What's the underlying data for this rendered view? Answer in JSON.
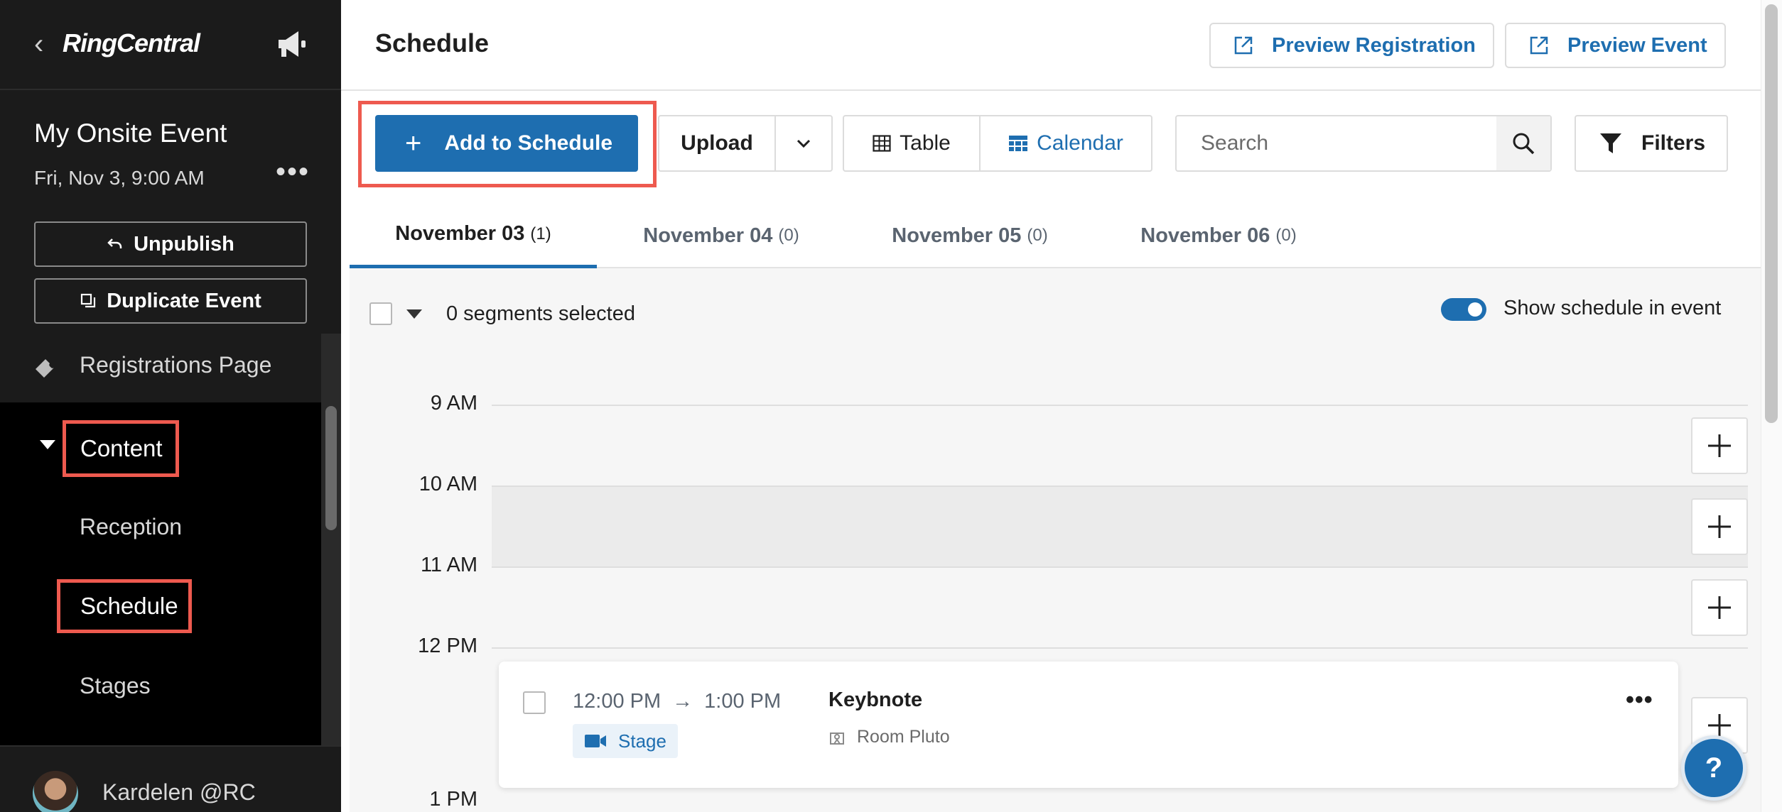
{
  "sidebar": {
    "brand": "RingCentral",
    "event_title": "My Onsite Event",
    "event_date": "Fri, Nov 3, 9:00 AM",
    "unpublish_label": "Unpublish",
    "duplicate_label": "Duplicate Event",
    "registrations_label": "Registrations Page",
    "content_label": "Content",
    "items": [
      {
        "label": "Reception"
      },
      {
        "label": "Schedule"
      },
      {
        "label": "Stages"
      }
    ],
    "user_name": "Kardelen @RC"
  },
  "header": {
    "title": "Schedule",
    "preview_registration": "Preview Registration",
    "preview_event": "Preview Event"
  },
  "toolbar": {
    "add_label": "Add to Schedule",
    "upload_label": "Upload",
    "table_label": "Table",
    "calendar_label": "Calendar",
    "search_placeholder": "Search",
    "filters_label": "Filters"
  },
  "tabs": [
    {
      "label": "November 03",
      "count": "(1)"
    },
    {
      "label": "November 04",
      "count": "(0)"
    },
    {
      "label": "November 05",
      "count": "(0)"
    },
    {
      "label": "November 06",
      "count": "(0)"
    }
  ],
  "selection": {
    "text": "0 segments selected",
    "toggle_label": "Show schedule in event",
    "toggle_on": true
  },
  "calendar": {
    "hours": [
      "9 AM",
      "10 AM",
      "11 AM",
      "12 PM",
      "1 PM"
    ]
  },
  "segment": {
    "start": "12:00 PM",
    "arrow": "→",
    "end": "1:00 PM",
    "tag": "Stage",
    "title": "Keybnote",
    "room": "Room Pluto"
  },
  "help_label": "?",
  "colors": {
    "accent": "#1e6eb0",
    "highlight": "#ee5a4f",
    "sidebar_bg": "#000000"
  }
}
